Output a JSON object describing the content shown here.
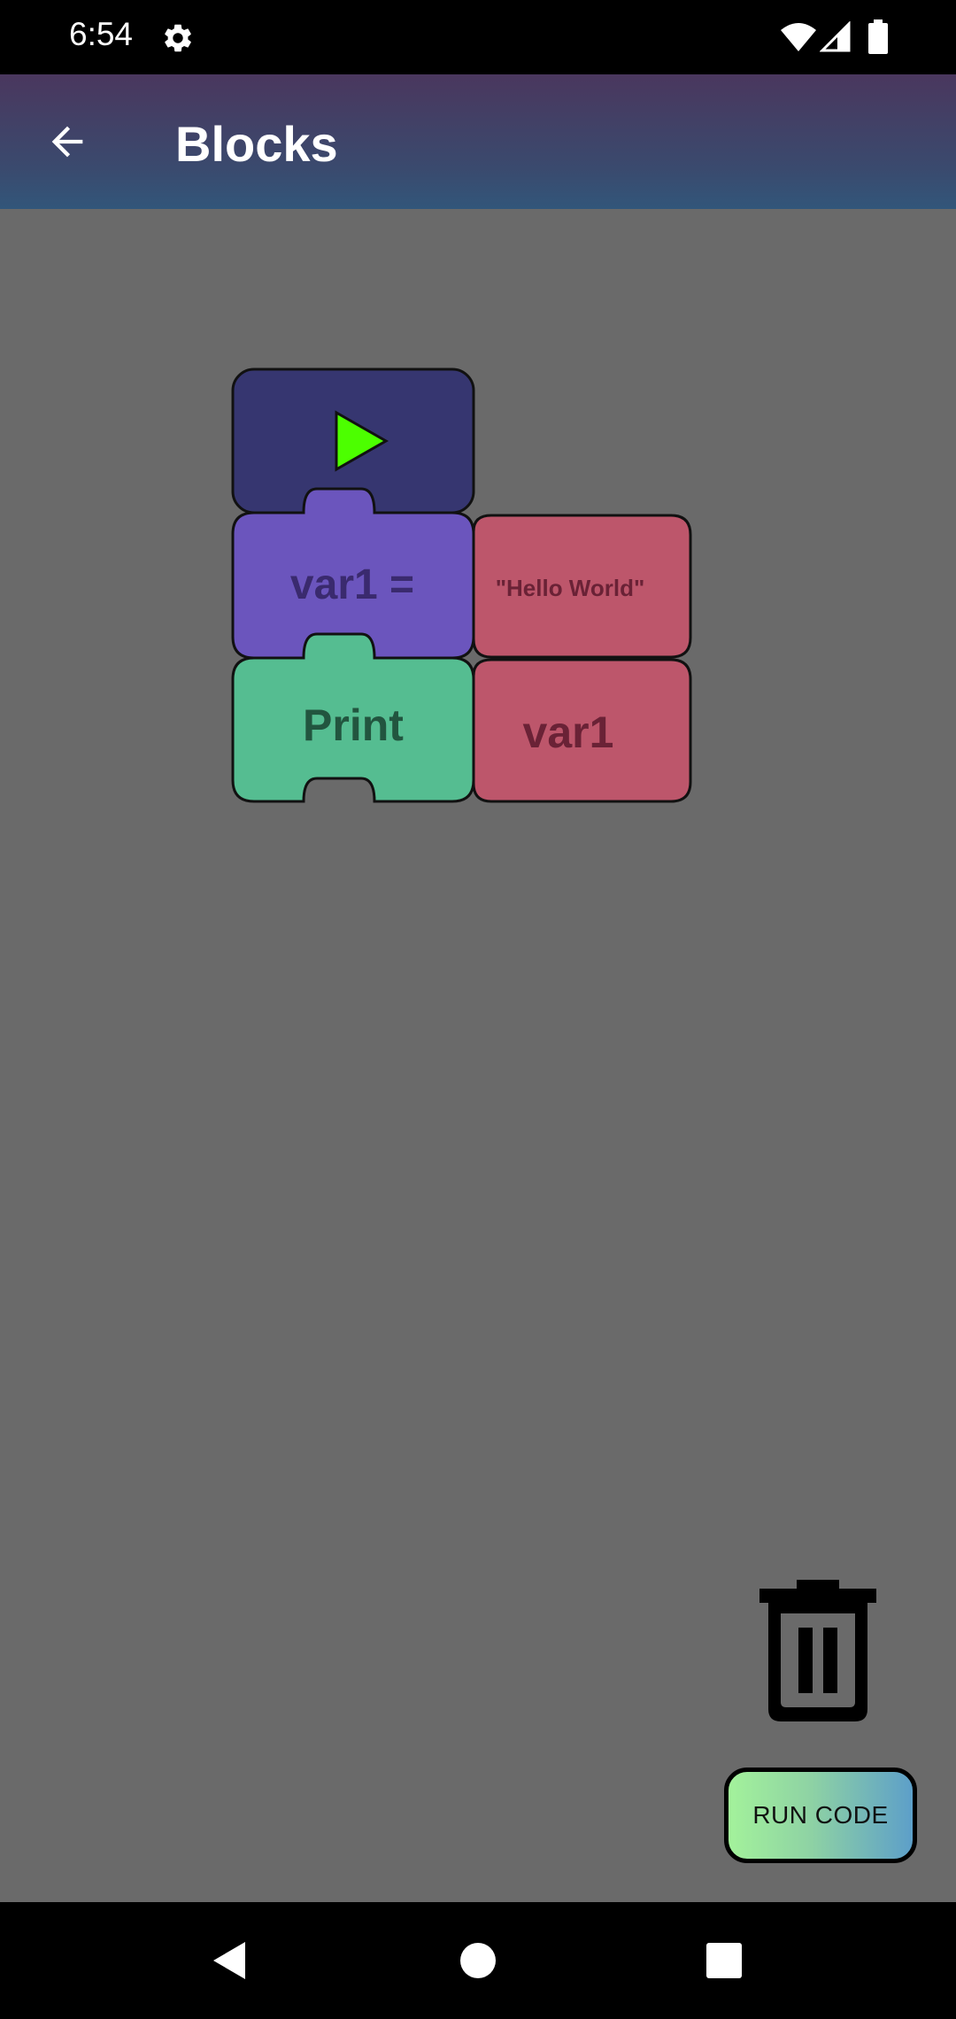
{
  "status_bar": {
    "time": "6:54",
    "icons": [
      "settings-icon",
      "wifi-icon",
      "signal-icon",
      "battery-icon"
    ]
  },
  "app_bar": {
    "title": "Blocks",
    "back_icon": "arrow-left-icon",
    "gradient": [
      "#4a375e",
      "#32567a"
    ]
  },
  "workspace": {
    "background": "#6a6a6a",
    "blocks": {
      "start": {
        "icon": "play-icon",
        "color": "#363670",
        "icon_color": "#4cff00"
      },
      "assign": {
        "label": "var1 =",
        "color": "#6b55bd",
        "text_color": "#3a2a6e"
      },
      "assign_value": {
        "label": "\"Hello World\"",
        "color": "#bd566b",
        "text_color": "#6a2236"
      },
      "print": {
        "label": "Print",
        "color": "#55bd91",
        "text_color": "#22553f"
      },
      "print_value": {
        "label": "var1",
        "color": "#bd566b",
        "text_color": "#6a2236"
      }
    }
  },
  "actions": {
    "trash_icon": "trash-icon",
    "run_label": "RUN CODE"
  },
  "nav_bar": {
    "icons": [
      "back-triangle-icon",
      "home-circle-icon",
      "recents-square-icon"
    ]
  }
}
